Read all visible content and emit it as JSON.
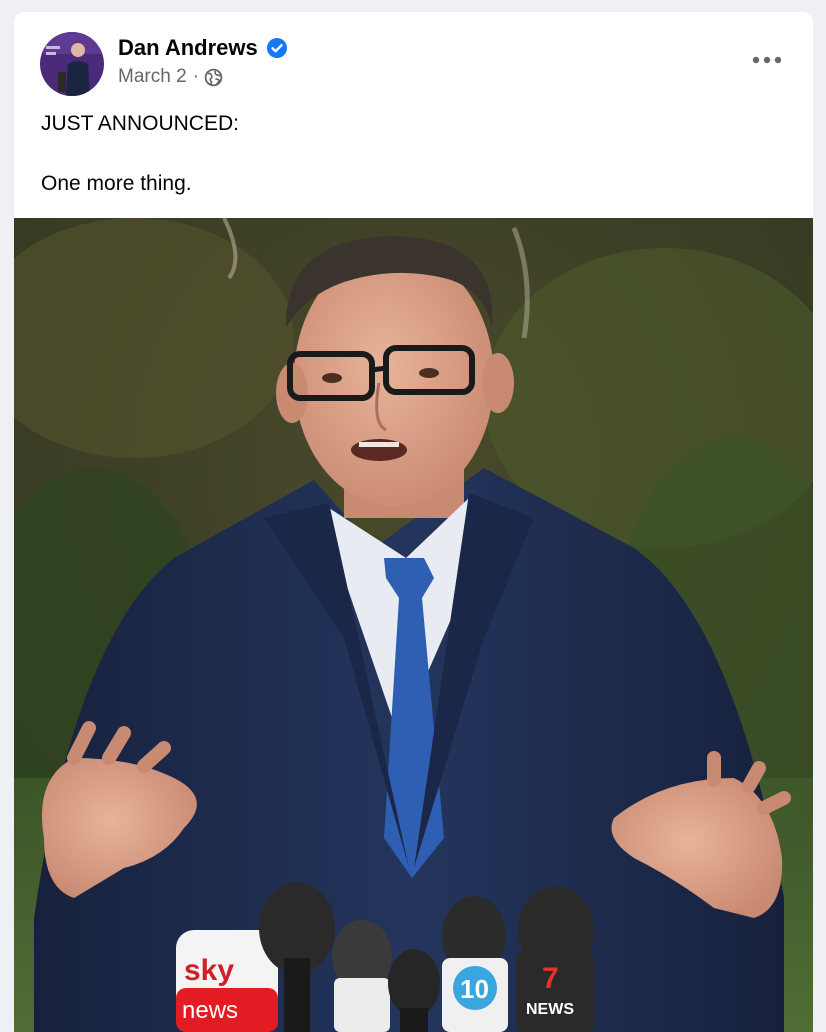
{
  "post": {
    "author": "Dan Andrews",
    "date": "March 2",
    "separator": "·",
    "text_line1": "JUST ANNOUNCED:",
    "text_line2": "One more thing.",
    "icons": {
      "verified": "verified-badge-icon",
      "audience": "globe-icon",
      "more": "more-options-icon"
    }
  },
  "photo": {
    "mic_labels": [
      "sky",
      "news",
      "10",
      "7",
      "NEWS"
    ]
  },
  "colors": {
    "verified_blue": "#1877f2",
    "secondary_text": "#65676b",
    "suit_navy": "#1f2f52",
    "tie_blue": "#2f5fb3",
    "sky_red": "#e31b23",
    "seven_red": "#e4322b"
  }
}
